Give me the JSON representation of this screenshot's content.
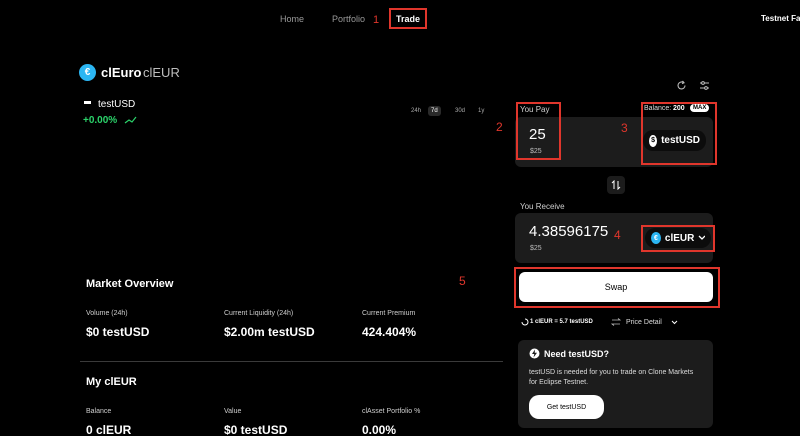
{
  "nav": {
    "home": "Home",
    "portfolio": "Portfolio",
    "trade": "Trade",
    "network": "Testnet Fau",
    "annotation_1": "1"
  },
  "asset": {
    "icon_glyph": "€",
    "name": "clEuro",
    "ticker": "clEUR"
  },
  "pair": {
    "label": "testUSD",
    "change": "+0.00%",
    "change_color": "#2bd46b"
  },
  "ranges": [
    "24h",
    "7d",
    "30d",
    "1y"
  ],
  "market_overview": {
    "title": "Market Overview",
    "stats": [
      {
        "label": "Volume (24h)",
        "value": "$0 testUSD"
      },
      {
        "label": "Current Liquidity (24h)",
        "value": "$2.00m testUSD"
      },
      {
        "label": "Current Premium",
        "value": "424.404%"
      }
    ]
  },
  "my_position": {
    "title": "My clEUR",
    "stats": [
      {
        "label": "Balance",
        "value": "0 clEUR"
      },
      {
        "label": "Value",
        "value": "$0 testUSD"
      },
      {
        "label": "clAsset Portfolio %",
        "value": "0.00%"
      }
    ]
  },
  "swap": {
    "pay_label": "You Pay",
    "pay_amount": "25",
    "pay_usd": "$25",
    "balance_label": "Balance:",
    "balance_value": "200",
    "max_label": "MAX",
    "pay_token": "testUSD",
    "pay_token_glyph": "$",
    "receive_label": "You Receive",
    "receive_amount": "4.38596175",
    "receive_usd": "$25",
    "receive_token": "clEUR",
    "receive_token_glyph": "€",
    "swap_button": "Swap",
    "rate": "1 clEUR = 5.7 testUSD",
    "price_detail": "Price Detail",
    "annotations": [
      "2",
      "3",
      "4",
      "5"
    ]
  },
  "need_box": {
    "title": "Need testUSD?",
    "body": "testUSD is needed for you to trade on Clone Markets for Eclipse Testnet.",
    "button": "Get testUSD"
  },
  "colors": {
    "accent_red": "#e0362c",
    "asset_blue": "#2bb6f3",
    "positive_green": "#2bd46b"
  }
}
